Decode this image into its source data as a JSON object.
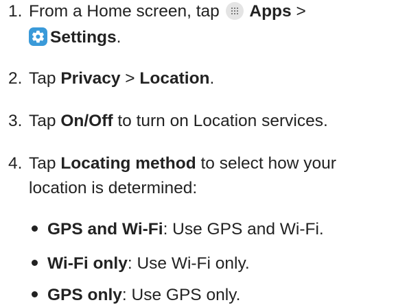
{
  "steps": [
    {
      "number": "1.",
      "pre": "From a Home screen, tap ",
      "apps_label": "Apps",
      "sep": " >",
      "settings_label": "Settings",
      "end": "."
    },
    {
      "number": "2.",
      "pre": "Tap ",
      "bold1": "Privacy",
      "sep": " > ",
      "bold2": "Location",
      "end": "."
    },
    {
      "number": "3.",
      "pre": "Tap ",
      "bold1": "On/Off",
      "rest": " to turn on Location services."
    },
    {
      "number": "4.",
      "pre": "Tap ",
      "bold1": "Locating method",
      "rest": " to select how your",
      "line2": "location is determined:"
    }
  ],
  "bullets": [
    {
      "label": "GPS and Wi-Fi",
      "text": ": Use GPS and Wi-Fi."
    },
    {
      "label": "Wi-Fi only",
      "text": ": Use Wi-Fi only."
    },
    {
      "label": "GPS only",
      "text": ": Use GPS only."
    }
  ],
  "icons": {
    "apps": "apps-grid-icon",
    "settings": "settings-gear-icon",
    "settings_color": "#3a9ad9"
  }
}
